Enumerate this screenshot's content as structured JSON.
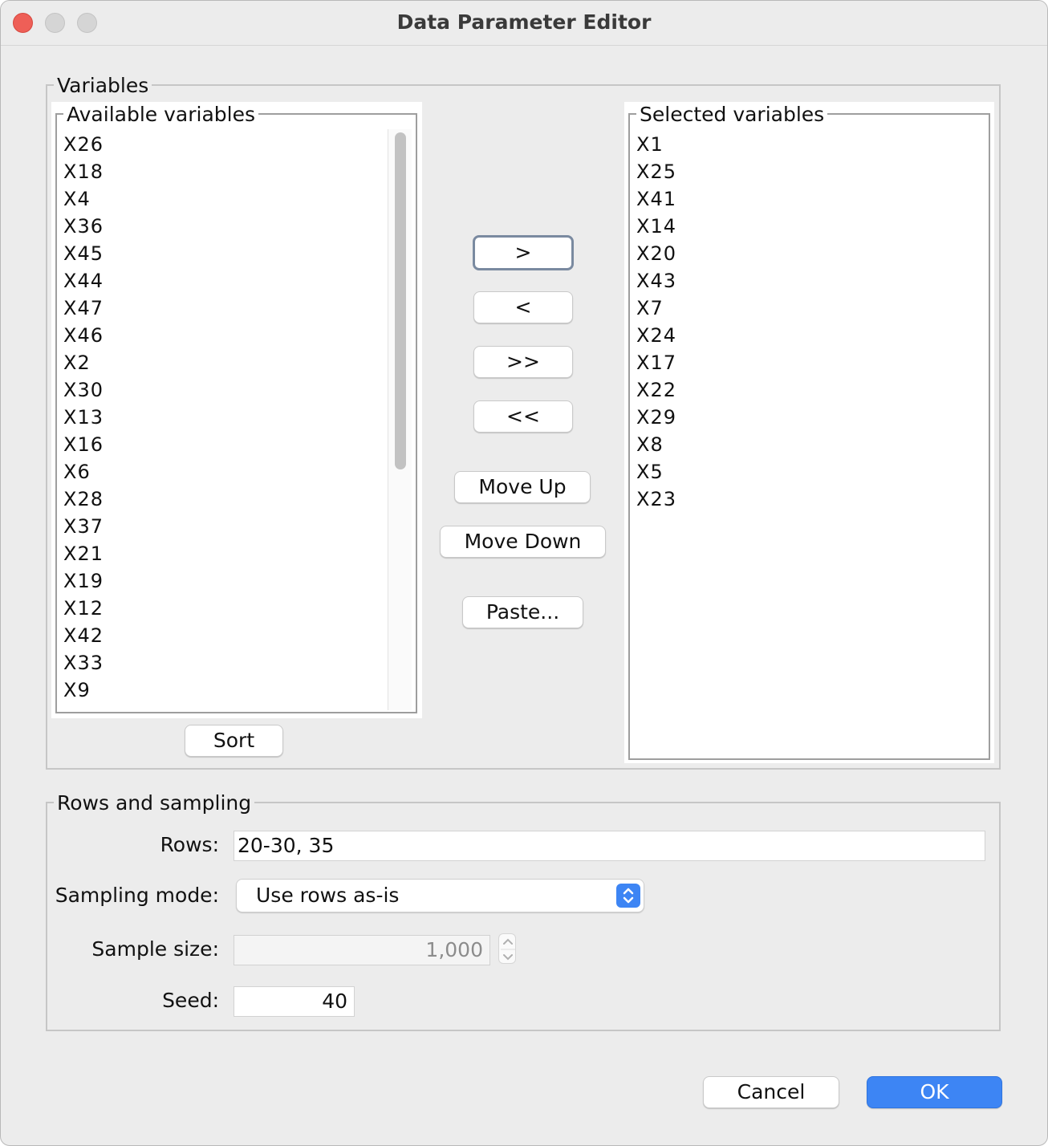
{
  "window": {
    "title": "Data Parameter Editor"
  },
  "variables": {
    "legend": "Variables",
    "available": {
      "legend": "Available variables",
      "items": [
        "X26",
        "X18",
        "X4",
        "X36",
        "X45",
        "X44",
        "X47",
        "X46",
        "X2",
        "X30",
        "X13",
        "X16",
        "X6",
        "X28",
        "X37",
        "X21",
        "X19",
        "X12",
        "X42",
        "X33",
        "X9"
      ]
    },
    "selected": {
      "legend": "Selected variables",
      "items": [
        "X1",
        "X25",
        "X41",
        "X14",
        "X20",
        "X43",
        "X7",
        "X24",
        "X17",
        "X22",
        "X29",
        "X8",
        "X5",
        "X23"
      ]
    },
    "buttons": {
      "move_right": ">",
      "move_left": "<",
      "move_all_right": ">>",
      "move_all_left": "<<",
      "move_up": "Move Up",
      "move_down": "Move Down",
      "paste": "Paste...",
      "sort": "Sort"
    }
  },
  "rows_sampling": {
    "legend": "Rows and sampling",
    "rows_label": "Rows:",
    "rows_value": "20-30, 35",
    "sampling_mode_label": "Sampling mode:",
    "sampling_mode_value": "Use rows as-is",
    "sample_size_label": "Sample size:",
    "sample_size_value": "1,000",
    "seed_label": "Seed:",
    "seed_value": "40"
  },
  "footer": {
    "cancel": "Cancel",
    "ok": "OK"
  },
  "colors": {
    "accent": "#3d85f4",
    "close": "#ee5f57"
  }
}
